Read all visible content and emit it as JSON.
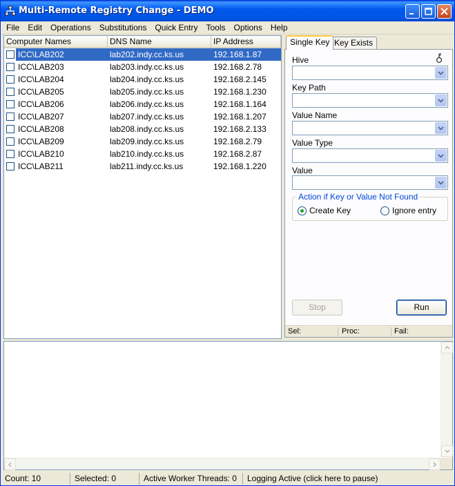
{
  "window": {
    "title": "Multi-Remote Registry Change - DEMO"
  },
  "menu": [
    "File",
    "Edit",
    "Operations",
    "Substitutions",
    "Quick Entry",
    "Tools",
    "Options",
    "Help"
  ],
  "list": {
    "columns": [
      "Computer Names",
      "DNS Name",
      "IP Address"
    ],
    "rows": [
      {
        "name": "ICC\\LAB202",
        "dns": "lab202.indy.cc.ks.us",
        "ip": "192.168.1.87",
        "selected": true
      },
      {
        "name": "ICC\\LAB203",
        "dns": "lab203.indy.cc.ks.us",
        "ip": "192.168.2.78",
        "selected": false
      },
      {
        "name": "ICC\\LAB204",
        "dns": "lab204.indy.cc.ks.us",
        "ip": "192.168.2.145",
        "selected": false
      },
      {
        "name": "ICC\\LAB205",
        "dns": "lab205.indy.cc.ks.us",
        "ip": "192.168.1.230",
        "selected": false
      },
      {
        "name": "ICC\\LAB206",
        "dns": "lab206.indy.cc.ks.us",
        "ip": "192.168.1.164",
        "selected": false
      },
      {
        "name": "ICC\\LAB207",
        "dns": "lab207.indy.cc.ks.us",
        "ip": "192.168.1.207",
        "selected": false
      },
      {
        "name": "ICC\\LAB208",
        "dns": "lab208.indy.cc.ks.us",
        "ip": "192.168.2.133",
        "selected": false
      },
      {
        "name": "ICC\\LAB209",
        "dns": "lab209.indy.cc.ks.us",
        "ip": "192.168.2.79",
        "selected": false
      },
      {
        "name": "ICC\\LAB210",
        "dns": "lab210.indy.cc.ks.us",
        "ip": "192.168.2.87",
        "selected": false
      },
      {
        "name": "ICC\\LAB211",
        "dns": "lab211.indy.cc.ks.us",
        "ip": "192.168.1.220",
        "selected": false
      }
    ]
  },
  "tabs": {
    "single_key": "Single Key",
    "key_exists": "Key Exists"
  },
  "form": {
    "hive_label": "Hive",
    "key_path_label": "Key Path",
    "value_name_label": "Value Name",
    "value_type_label": "Value Type",
    "value_label": "Value",
    "hive_value": "",
    "key_path_value": "",
    "value_name_value": "",
    "value_type_value": "",
    "value_value": ""
  },
  "action_group": {
    "title": "Action if Key or Value Not Found",
    "create_key": "Create Key",
    "ignore_entry": "Ignore entry",
    "selected": "create_key"
  },
  "buttons": {
    "stop": "Stop",
    "run": "Run"
  },
  "mini_status": {
    "sel": "Sel:",
    "proc": "Proc:",
    "fail": "Fail:"
  },
  "statusbar": {
    "count": "Count: 10",
    "selected": "Selected: 0",
    "threads": "Active Worker Threads: 0",
    "logging": "Logging Active (click here to pause)"
  },
  "colors": {
    "selection": "#316ac5",
    "titlebar": "#0054e3",
    "tab_highlight": "#ffc83c",
    "group_title": "#0046d5"
  }
}
